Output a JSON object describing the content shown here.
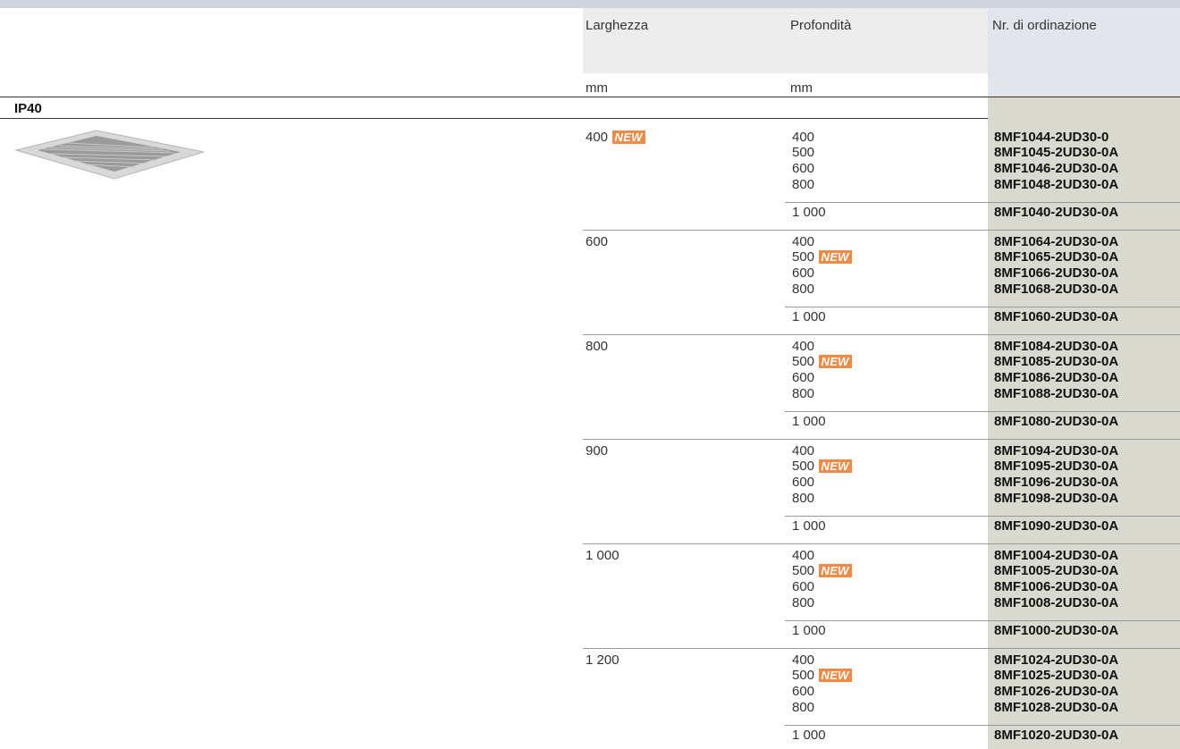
{
  "header": {
    "larghezza": "Larghezza",
    "profondita": "Profondità",
    "nr_ordinazione": "Nr. di ordinazione",
    "unit_larghezza": "mm",
    "unit_profondita": "mm"
  },
  "section_label": "IP40",
  "new_label": "NEW",
  "groups": [
    {
      "width": "400",
      "width_new": true,
      "rows": [
        {
          "depth": "400",
          "order": "8MF1044-2UD30-0",
          "new": false
        },
        {
          "depth": "500",
          "order": "8MF1045-2UD30-0A",
          "new": false
        },
        {
          "depth": "600",
          "order": "8MF1046-2UD30-0A",
          "new": false
        },
        {
          "depth": "800",
          "order": "8MF1048-2UD30-0A",
          "new": false
        },
        {
          "depth": "1 000",
          "order": "8MF1040-2UD30-0A",
          "new": false
        }
      ]
    },
    {
      "width": "600",
      "width_new": false,
      "rows": [
        {
          "depth": "400",
          "order": "8MF1064-2UD30-0A",
          "new": false
        },
        {
          "depth": "500",
          "order": "8MF1065-2UD30-0A",
          "new": true
        },
        {
          "depth": "600",
          "order": "8MF1066-2UD30-0A",
          "new": false
        },
        {
          "depth": "800",
          "order": "8MF1068-2UD30-0A",
          "new": false
        },
        {
          "depth": "1 000",
          "order": "8MF1060-2UD30-0A",
          "new": false
        }
      ]
    },
    {
      "width": "800",
      "width_new": false,
      "rows": [
        {
          "depth": "400",
          "order": "8MF1084-2UD30-0A",
          "new": false
        },
        {
          "depth": "500",
          "order": "8MF1085-2UD30-0A",
          "new": true
        },
        {
          "depth": "600",
          "order": "8MF1086-2UD30-0A",
          "new": false
        },
        {
          "depth": "800",
          "order": "8MF1088-2UD30-0A",
          "new": false
        },
        {
          "depth": "1 000",
          "order": "8MF1080-2UD30-0A",
          "new": false
        }
      ]
    },
    {
      "width": "900",
      "width_new": false,
      "rows": [
        {
          "depth": "400",
          "order": "8MF1094-2UD30-0A",
          "new": false
        },
        {
          "depth": "500",
          "order": "8MF1095-2UD30-0A",
          "new": true
        },
        {
          "depth": "600",
          "order": "8MF1096-2UD30-0A",
          "new": false
        },
        {
          "depth": "800",
          "order": "8MF1098-2UD30-0A",
          "new": false
        },
        {
          "depth": "1 000",
          "order": "8MF1090-2UD30-0A",
          "new": false
        }
      ]
    },
    {
      "width": "1 000",
      "width_new": false,
      "rows": [
        {
          "depth": "400",
          "order": "8MF1004-2UD30-0A",
          "new": false
        },
        {
          "depth": "500",
          "order": "8MF1005-2UD30-0A",
          "new": true
        },
        {
          "depth": "600",
          "order": "8MF1006-2UD30-0A",
          "new": false
        },
        {
          "depth": "800",
          "order": "8MF1008-2UD30-0A",
          "new": false
        },
        {
          "depth": "1 000",
          "order": "8MF1000-2UD30-0A",
          "new": false
        }
      ]
    },
    {
      "width": "1 200",
      "width_new": false,
      "rows": [
        {
          "depth": "400",
          "order": "8MF1024-2UD30-0A",
          "new": false
        },
        {
          "depth": "500",
          "order": "8MF1025-2UD30-0A",
          "new": true
        },
        {
          "depth": "600",
          "order": "8MF1026-2UD30-0A",
          "new": false
        },
        {
          "depth": "800",
          "order": "8MF1028-2UD30-0A",
          "new": false
        },
        {
          "depth": "1 000",
          "order": "8MF1020-2UD30-0A",
          "new": false
        }
      ]
    }
  ]
}
